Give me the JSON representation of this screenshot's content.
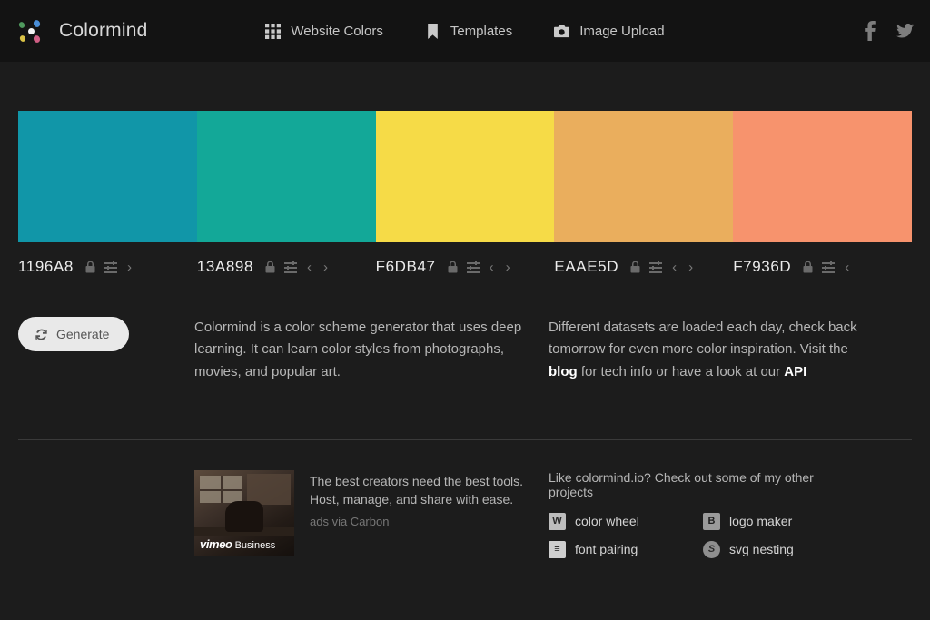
{
  "brand": {
    "name": "Colormind",
    "logo_icon": "colormind-dots-logo"
  },
  "nav": {
    "items": [
      {
        "label": "Website Colors",
        "icon": "grid-icon"
      },
      {
        "label": "Templates",
        "icon": "bookmark-icon"
      },
      {
        "label": "Image Upload",
        "icon": "camera-icon"
      }
    ],
    "social": [
      {
        "name": "facebook-icon"
      },
      {
        "name": "twitter-icon"
      }
    ]
  },
  "palette": {
    "swatches": [
      {
        "hex": "1196A8",
        "color": "#1196a8",
        "lock": "lock-icon",
        "adjust": "sliders-icon",
        "prev": false,
        "next": true
      },
      {
        "hex": "13A898",
        "color": "#13a898",
        "lock": "lock-icon",
        "adjust": "sliders-icon",
        "prev": true,
        "next": true
      },
      {
        "hex": "F6DB47",
        "color": "#f6db47",
        "lock": "lock-icon",
        "adjust": "sliders-icon",
        "prev": true,
        "next": true
      },
      {
        "hex": "EAAE5D",
        "color": "#eaae5d",
        "lock": "lock-icon",
        "adjust": "sliders-icon",
        "prev": true,
        "next": true
      },
      {
        "hex": "F7936D",
        "color": "#f7936d",
        "lock": "lock-icon",
        "adjust": "sliders-icon",
        "prev": true,
        "next": false
      }
    ],
    "prev_glyph": "‹",
    "next_glyph": "›"
  },
  "actions": {
    "generate_label": "Generate",
    "generate_icon": "refresh-icon"
  },
  "about": {
    "paragraph1": "Colormind is a color scheme generator that uses deep learning. It can learn color styles from photographs, movies, and popular art.",
    "paragraph2_part1": "Different datasets are loaded each day, check back tomorrow for even more color inspiration. Visit the ",
    "blog_link": "blog",
    "paragraph2_part2": " for tech info or have a look at our ",
    "api_link": "API"
  },
  "ad": {
    "text": "The best creators need the best tools. Host, manage, and share with ease.",
    "via": "ads via Carbon",
    "brand_italic": "vimeo",
    "brand_rest": "Business"
  },
  "projects": {
    "heading": "Like colormind.io? Check out some of my other projects",
    "items": [
      {
        "label": "color wheel",
        "icon": "color-wheel-icon",
        "glyph": "W"
      },
      {
        "label": "logo maker",
        "icon": "logo-maker-icon",
        "glyph": "B"
      },
      {
        "label": "font pairing",
        "icon": "font-pairing-icon",
        "glyph": "≡"
      },
      {
        "label": "svg nesting",
        "icon": "svg-nesting-icon",
        "glyph": "S"
      }
    ]
  }
}
